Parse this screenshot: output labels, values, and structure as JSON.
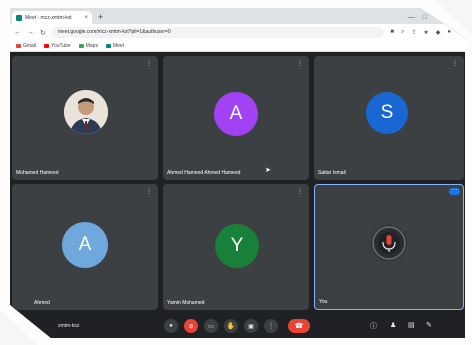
{
  "browser": {
    "tab_title": "Meet - mcz-xmtm-kxt",
    "new_tab": "+",
    "url": "meet.google.com/mcz-xmtm-kxt?pli=1&authuser=0",
    "bookmarks": [
      {
        "label": "Gmail",
        "color": "#ea4335"
      },
      {
        "label": "YouTube",
        "color": "#ff0000"
      },
      {
        "label": "Maps",
        "color": "#34a853"
      },
      {
        "label": "Meet",
        "color": "#00897b"
      }
    ]
  },
  "participants": [
    {
      "name": "Mohamed Hameed",
      "type": "photo"
    },
    {
      "name": "Ahmed Hameed Ahmed Hameed",
      "type": "initial",
      "initial": "A",
      "color": "#a142f4"
    },
    {
      "name": "Sattar Ismail",
      "type": "initial",
      "initial": "S",
      "color": "#1967d2"
    },
    {
      "name": "Ahmed",
      "type": "initial",
      "initial": "A",
      "color": "#6fa8dc"
    },
    {
      "name": "Yamin Mohamed",
      "type": "initial",
      "initial": "Y",
      "color": "#188038"
    },
    {
      "name": "You",
      "type": "self"
    }
  ],
  "toolbar": {
    "meeting_code": "xmtm-kxz"
  },
  "colors": {
    "meet_bg": "#202124",
    "tile_bg": "#3c4043",
    "end_call": "#ea4335",
    "self_border": "#8ab4f8"
  }
}
